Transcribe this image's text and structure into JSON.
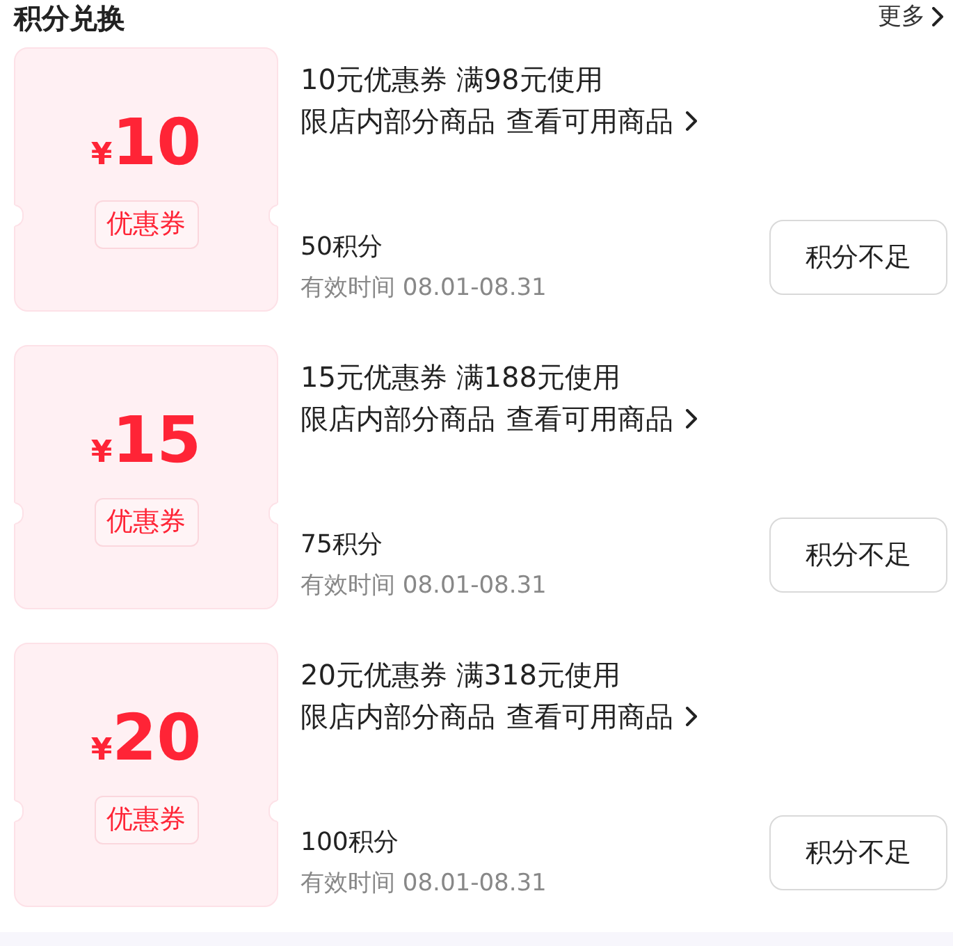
{
  "section": {
    "title": "积分兑换",
    "more": "更多"
  },
  "coupons": [
    {
      "currency": "¥",
      "amount": "10",
      "badge": "优惠券",
      "title": "10元优惠券 满98元使用",
      "scope": "限店内部分商品",
      "link": "查看可用商品",
      "points": "50积分",
      "validity": "有效时间 08.01-08.31",
      "button": "积分不足"
    },
    {
      "currency": "¥",
      "amount": "15",
      "badge": "优惠券",
      "title": "15元优惠券 满188元使用",
      "scope": "限店内部分商品",
      "link": "查看可用商品",
      "points": "75积分",
      "validity": "有效时间 08.01-08.31",
      "button": "积分不足"
    },
    {
      "currency": "¥",
      "amount": "20",
      "badge": "优惠券",
      "title": "20元优惠券 满318元使用",
      "scope": "限店内部分商品",
      "link": "查看可用商品",
      "points": "100积分",
      "validity": "有效时间 08.01-08.31",
      "button": "积分不足"
    }
  ]
}
